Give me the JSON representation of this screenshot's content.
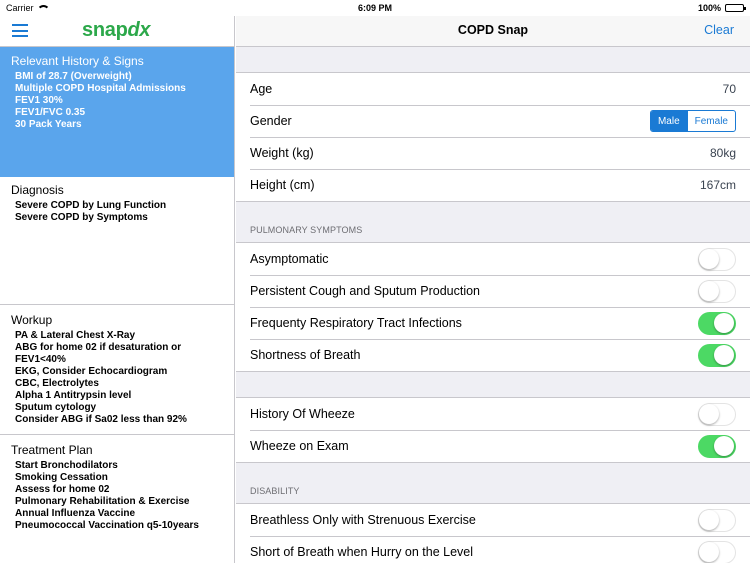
{
  "status_bar": {
    "carrier": "Carrier",
    "time": "6:09 PM",
    "battery": "100%"
  },
  "left": {
    "logo_main": "snap",
    "logo_accent": "dx",
    "history": {
      "title": "Relevant History & Signs",
      "items": [
        "BMI of 28.7 (Overweight)",
        "Multiple COPD Hospital Admissions",
        "FEV1 30%",
        "FEV1/FVC 0.35",
        "30 Pack Years"
      ]
    },
    "diagnosis": {
      "title": "Diagnosis",
      "items": [
        "Severe COPD by Lung Function",
        "Severe COPD by Symptoms"
      ]
    },
    "workup": {
      "title": "Workup",
      "items": [
        "PA & Lateral Chest X-Ray",
        "ABG for home 02 if desaturation or",
        "FEV1<40%",
        "EKG, Consider Echocardiogram",
        "CBC, Electrolytes",
        "Alpha 1 Antitrypsin level",
        "Sputum cytology",
        "Consider ABG if Sa02 less than 92%"
      ]
    },
    "plan": {
      "title": "Treatment Plan",
      "items": [
        "Start Bronchodilators",
        "Smoking Cessation",
        "Assess for home 02",
        "Pulmonary Rehabilitation & Exercise",
        "Annual Influenza Vaccine",
        "Pneumococcal Vaccination q5-10years"
      ]
    }
  },
  "right": {
    "title": "COPD Snap",
    "clear_label": "Clear",
    "demographics": {
      "age_label": "Age",
      "age_value": "70",
      "gender_label": "Gender",
      "gender_male": "Male",
      "gender_female": "Female",
      "gender_selected": "Male",
      "weight_label": "Weight (kg)",
      "weight_value": "80kg",
      "height_label": "Height (cm)",
      "height_value": "167cm"
    },
    "pulmonary_header": "PULMONARY SYMPTOMS",
    "pulmonary": [
      {
        "label": "Asymptomatic",
        "on": false
      },
      {
        "label": "Persistent Cough and Sputum Production",
        "on": false
      },
      {
        "label": "Frequenty Respiratory Tract Infections",
        "on": true
      },
      {
        "label": "Shortness of Breath",
        "on": true
      }
    ],
    "wheeze": [
      {
        "label": "History Of Wheeze",
        "on": false
      },
      {
        "label": "Wheeze on Exam",
        "on": true
      }
    ],
    "disability_header": "DISABILITY",
    "disability": [
      {
        "label": "Breathless Only with Strenuous Exercise",
        "on": false
      },
      {
        "label": "Short of Breath when Hurry on the Level",
        "on": false
      }
    ]
  },
  "colors": {
    "accent": "#1a7ad4",
    "logo": "#2ca84a",
    "highlight": "#5aa5ec",
    "toggle_on": "#4cd964"
  }
}
